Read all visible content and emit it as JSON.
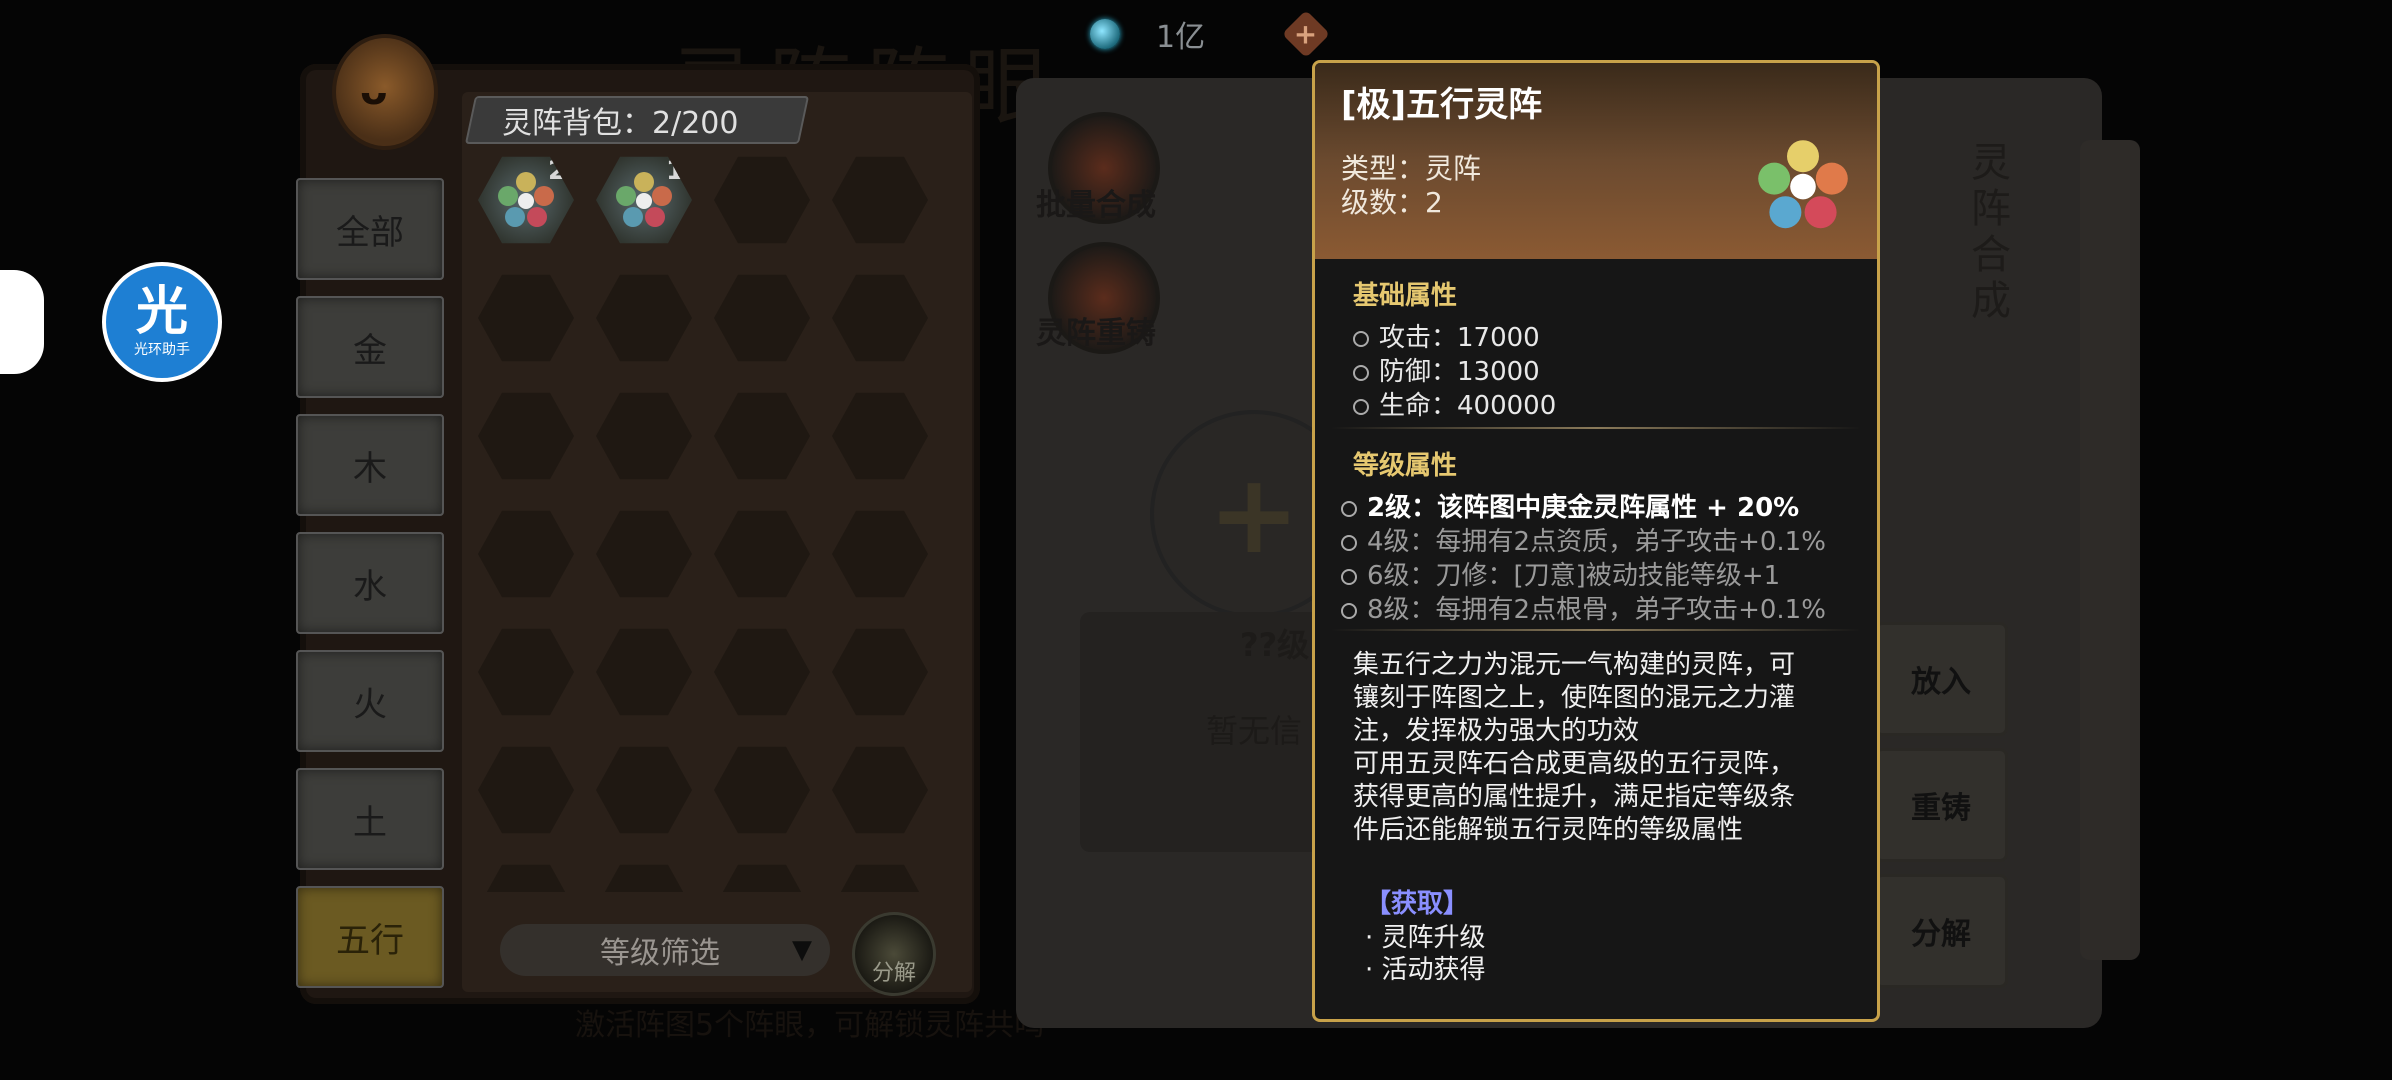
{
  "topbar": {
    "currency_value": "1亿"
  },
  "background_title": "灵阵阵眼",
  "left_panel": {
    "bag_label": "灵阵背包：2/200",
    "tabs": [
      "全部",
      "金",
      "木",
      "水",
      "火",
      "土",
      "五行"
    ],
    "active_tab": "五行",
    "items": [
      {
        "count": "2"
      },
      {
        "count": "1"
      }
    ],
    "filter_label": "等级筛选",
    "decompose_label": "分解",
    "bottom_hint": "激活阵图5个阵眼，可解锁灵阵共鸣"
  },
  "right_panel": {
    "batch_synth_label": "批量合成",
    "reforge_label": "灵阵重铸",
    "level_unknown": "??级",
    "no_info": "暂无信",
    "vertical_title": "灵阵合成",
    "side_buttons": [
      "放入",
      "重铸",
      "分解"
    ]
  },
  "assistant": {
    "big": "光",
    "small": "光环助手"
  },
  "tooltip": {
    "title": "[极]五行灵阵",
    "type": "类型：灵阵",
    "level": "级数：2",
    "base_title": "基础属性",
    "base_attrs": [
      "攻击：17000",
      "防御：13000",
      "生命：400000"
    ],
    "level_title": "等级属性",
    "level_attrs": [
      {
        "text": "2级：该阵图中庚金灵阵属性 + 20%",
        "active": true
      },
      {
        "text": "4级：每拥有2点资质，弟子攻击+0.1%",
        "active": false
      },
      {
        "text": "6级：刀修：[刀意]被动技能等级+1",
        "active": false
      },
      {
        "text": "8级：每拥有2点根骨，弟子攻击+0.1%",
        "active": false
      }
    ],
    "description_lines": [
      "集五行之力为混元一气构建的灵阵，可",
      "镶刻于阵图之上，使阵图的混元之力灌",
      "注，发挥极为强大的功效",
      "可用五灵阵石合成更高级的五行灵阵，",
      "获得更高的属性提升，满足指定等级条",
      "件后还能解锁五行灵阵的等级属性"
    ],
    "obtain_title": "【获取】",
    "obtain_items": [
      "· 灵阵升级",
      "· 活动获得"
    ]
  }
}
